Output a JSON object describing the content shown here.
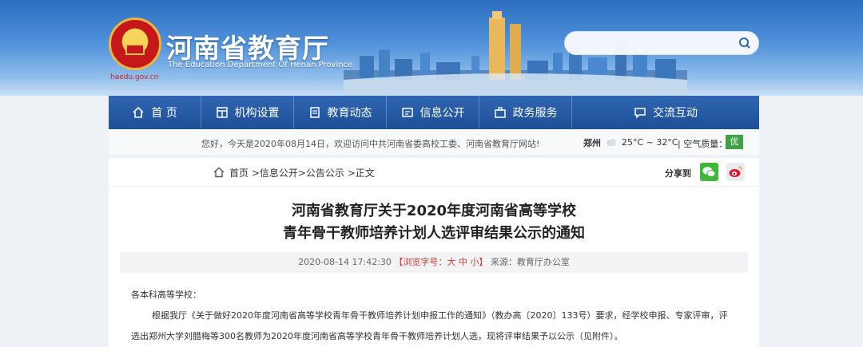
{
  "header": {
    "title": "河南省教育厅",
    "subtitle": "The Education Department Of Henan Province",
    "domain": "haedu.gov.cn",
    "emblem_icon": "national-emblem-icon",
    "search": {
      "placeholder": "",
      "icon": "search-icon"
    }
  },
  "nav": {
    "items": [
      {
        "label": "首 页",
        "icon": "home-icon"
      },
      {
        "label": "机构设置",
        "icon": "org-chart-icon"
      },
      {
        "label": "教育动态",
        "icon": "document-icon"
      },
      {
        "label": "信息公开",
        "icon": "info-icon"
      },
      {
        "label": "政务服务",
        "icon": "briefcase-icon"
      },
      {
        "label": "交流互动",
        "icon": "chat-icon"
      }
    ]
  },
  "infobar": {
    "welcome": "您好，今天是2020年08月14日，欢迎访问中共河南省委高校工委、河南省教育厅网站!",
    "city": "郑州",
    "temperature": "25°C ~ 32°C",
    "air_quality_label": "| 空气质量：",
    "air_quality_value": "优",
    "weather_icon": "cloudy-icon"
  },
  "breadcrumb": {
    "text": "首页 >信息公开>公告公示 >正文",
    "share_label": "分享到"
  },
  "article": {
    "title_line1": "河南省教育厅关于2020年度河南省高等学校",
    "title_line2": "青年骨干教师培养计划人选评审结果公示的通知",
    "date": "2020-08-14 17:42:30",
    "font_size_control": "【浏览字号：大 中 小】",
    "source": "来源：教育厅办公室",
    "salutation": "各本科高等学校：",
    "para1_line1": "根据我厅《关于做好2020年度河南省高等学校青年骨干教师培养计划申报工作的通知》（教办高〔2020〕133号）要求，经学校申报、专家评审，评",
    "para1_line2": "选出郑州大学刘腊梅等300名教师为2020年度河南省高等学校青年骨干教师培养计划人选，现将评审结果予以公示（见附件）。"
  },
  "colors": {
    "nav_bg": "#22539b",
    "banner_sky": "#4f91da",
    "air_quality_good": "#3ea345",
    "wechat_green": "#3fb83a",
    "font_size_red": "#d03a2c"
  }
}
